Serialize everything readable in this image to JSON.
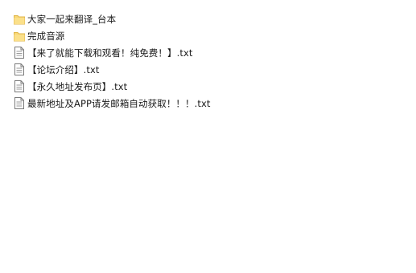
{
  "files": [
    {
      "name": "大家一起来翻译_台本",
      "icon": "folder-icon"
    },
    {
      "name": "完成音源",
      "icon": "folder-icon"
    },
    {
      "name": "【来了就能下载和观看！纯免费！】.txt",
      "icon": "text-file-icon"
    },
    {
      "name": "【论坛介绍】.txt",
      "icon": "text-file-icon"
    },
    {
      "name": "【永久地址发布页】.txt",
      "icon": "text-file-icon"
    },
    {
      "name": "最新地址及APP请发邮箱自动获取！！！.txt",
      "icon": "text-file-icon"
    }
  ],
  "colors": {
    "folder": "#f8d775",
    "folder_edge": "#e0b64a",
    "file_outline": "#7a7a7a"
  }
}
